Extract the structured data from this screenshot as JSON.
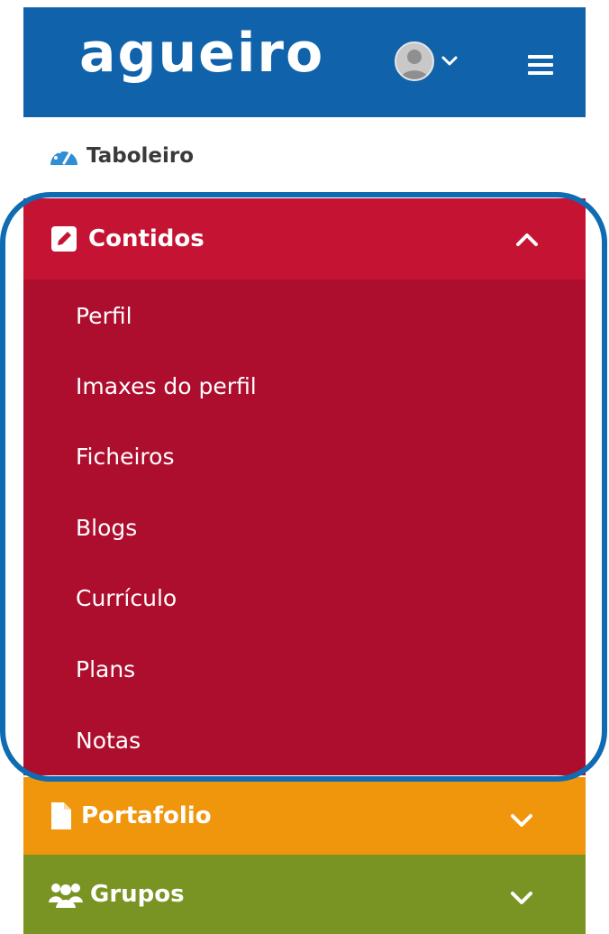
{
  "header": {
    "logo_text": "agueiro",
    "brand_color": "#1063ab",
    "icons": [
      "user-avatar-icon",
      "chevron-down-icon",
      "hamburger-menu-icon"
    ]
  },
  "nav": {
    "dashboard": {
      "label": "Taboleiro",
      "icon": "dashboard-gauge-icon"
    },
    "content": {
      "label": "Contidos",
      "icon": "edit-icon",
      "expanded": true,
      "color": "#c51333",
      "submenu_color": "#ae0e2e",
      "items": [
        "Perfil",
        "Imaxes do perfil",
        "Ficheiros",
        "Blogs",
        "Currículo",
        "Plans",
        "Notas"
      ]
    },
    "portfolio": {
      "label": "Portafolio",
      "icon": "file-icon",
      "color": "#f0960c"
    },
    "groups": {
      "label": "Grupos",
      "icon": "users-icon",
      "color": "#799423"
    }
  },
  "annotation": {
    "highlight_color": "#0f6cb2"
  }
}
